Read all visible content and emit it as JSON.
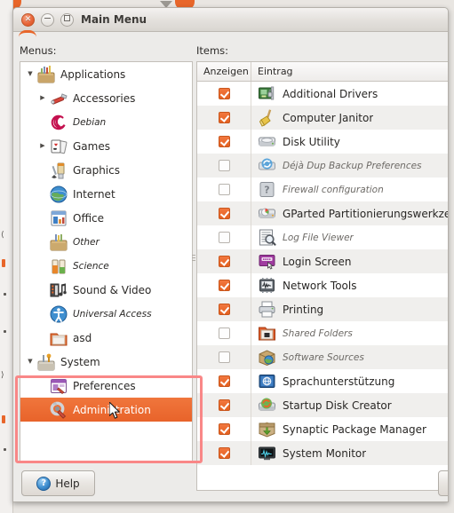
{
  "window": {
    "title": "Main Menu",
    "controls": {
      "close": "close-button",
      "minimize": "minimize-button",
      "maximize": "maximize-button"
    }
  },
  "labels": {
    "menus": "Menus:",
    "items": "Items:"
  },
  "tree": {
    "items": [
      {
        "label": "Applications",
        "level": 1,
        "expander": "down",
        "icon": "applications-icon",
        "italic": false,
        "selected": false
      },
      {
        "label": "Accessories",
        "level": 2,
        "expander": "right",
        "icon": "accessories-icon",
        "italic": false,
        "selected": false
      },
      {
        "label": "Debian",
        "level": 2,
        "expander": "none",
        "icon": "debian-icon",
        "italic": true,
        "selected": false
      },
      {
        "label": "Games",
        "level": 2,
        "expander": "right",
        "icon": "games-icon",
        "italic": false,
        "selected": false
      },
      {
        "label": "Graphics",
        "level": 2,
        "expander": "none",
        "icon": "graphics-icon",
        "italic": false,
        "selected": false
      },
      {
        "label": "Internet",
        "level": 2,
        "expander": "none",
        "icon": "internet-icon",
        "italic": false,
        "selected": false
      },
      {
        "label": "Office",
        "level": 2,
        "expander": "none",
        "icon": "office-icon",
        "italic": false,
        "selected": false
      },
      {
        "label": "Other",
        "level": 2,
        "expander": "none",
        "icon": "other-icon",
        "italic": true,
        "selected": false
      },
      {
        "label": "Science",
        "level": 2,
        "expander": "none",
        "icon": "science-icon",
        "italic": true,
        "selected": false
      },
      {
        "label": "Sound & Video",
        "level": 2,
        "expander": "none",
        "icon": "sound-video-icon",
        "italic": false,
        "selected": false
      },
      {
        "label": "Universal Access",
        "level": 2,
        "expander": "none",
        "icon": "universal-access-icon",
        "italic": true,
        "selected": false
      },
      {
        "label": "asd",
        "level": 2,
        "expander": "none",
        "icon": "folder-icon",
        "italic": false,
        "selected": false
      },
      {
        "label": "System",
        "level": 1,
        "expander": "down",
        "icon": "system-icon",
        "italic": false,
        "selected": false
      },
      {
        "label": "Preferences",
        "level": 2,
        "expander": "none",
        "icon": "preferences-icon",
        "italic": false,
        "selected": false
      },
      {
        "label": "Administration",
        "level": 2,
        "expander": "none",
        "icon": "administration-icon",
        "italic": false,
        "selected": true
      }
    ]
  },
  "items_list": {
    "columns": [
      "Anzeigen",
      "Eintrag"
    ],
    "rows": [
      {
        "checked": true,
        "label": "Additional Drivers",
        "icon": "additional-drivers-icon"
      },
      {
        "checked": true,
        "label": "Computer Janitor",
        "icon": "computer-janitor-icon"
      },
      {
        "checked": true,
        "label": "Disk Utility",
        "icon": "disk-utility-icon"
      },
      {
        "checked": false,
        "label": "Déjà Dup Backup Preferences",
        "icon": "deja-dup-icon"
      },
      {
        "checked": false,
        "label": "Firewall configuration",
        "icon": "firewall-icon"
      },
      {
        "checked": true,
        "label": "GParted Partitionierungswerkzeug",
        "icon": "gparted-icon"
      },
      {
        "checked": false,
        "label": "Log File Viewer",
        "icon": "log-file-viewer-icon"
      },
      {
        "checked": true,
        "label": "Login Screen",
        "icon": "login-screen-icon"
      },
      {
        "checked": true,
        "label": "Network Tools",
        "icon": "network-tools-icon"
      },
      {
        "checked": true,
        "label": "Printing",
        "icon": "printing-icon"
      },
      {
        "checked": false,
        "label": "Shared Folders",
        "icon": "shared-folders-icon"
      },
      {
        "checked": false,
        "label": "Software Sources",
        "icon": "software-sources-icon"
      },
      {
        "checked": true,
        "label": "Sprachunterstützung",
        "icon": "language-support-icon"
      },
      {
        "checked": true,
        "label": "Startup Disk Creator",
        "icon": "startup-disk-creator-icon"
      },
      {
        "checked": true,
        "label": "Synaptic Package Manager",
        "icon": "synaptic-icon"
      },
      {
        "checked": true,
        "label": "System Monitor",
        "icon": "system-monitor-icon"
      }
    ]
  },
  "buttons": {
    "help": "Help",
    "right_partial": ""
  },
  "colors": {
    "selection": "#e8632a",
    "checkbox": "#e4601f",
    "annotation": "#f98787",
    "window_bg": "#ecebe9",
    "list_alt_row": "#f0efed"
  }
}
